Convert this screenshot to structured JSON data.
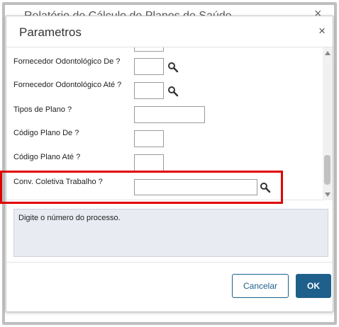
{
  "background": {
    "title": "Relatório de Cálculo de Planos de Saúde",
    "close_glyph": "×"
  },
  "dialog": {
    "title": "Parametros",
    "close_glyph": "×"
  },
  "fields": [
    {
      "label": "Fornecedor Odontológico De ?",
      "value": "",
      "has_lookup": true
    },
    {
      "label": "Fornecedor Odontológico Até ?",
      "value": "",
      "has_lookup": true
    },
    {
      "label": "Tipos de Plano ?",
      "value": ""
    },
    {
      "label": "Código Plano De ?",
      "value": ""
    },
    {
      "label": "Código Plano Até ?",
      "value": ""
    },
    {
      "label": "Conv. Coletiva Trabalho ?",
      "value": "",
      "has_lookup": true
    }
  ],
  "help": {
    "text": "Digite o número do processo."
  },
  "buttons": {
    "cancel": "Cancelar",
    "ok": "OK"
  },
  "colors": {
    "primary": "#1f5f8b",
    "highlight": "#e00000",
    "help_bg": "#e8ebf2"
  }
}
